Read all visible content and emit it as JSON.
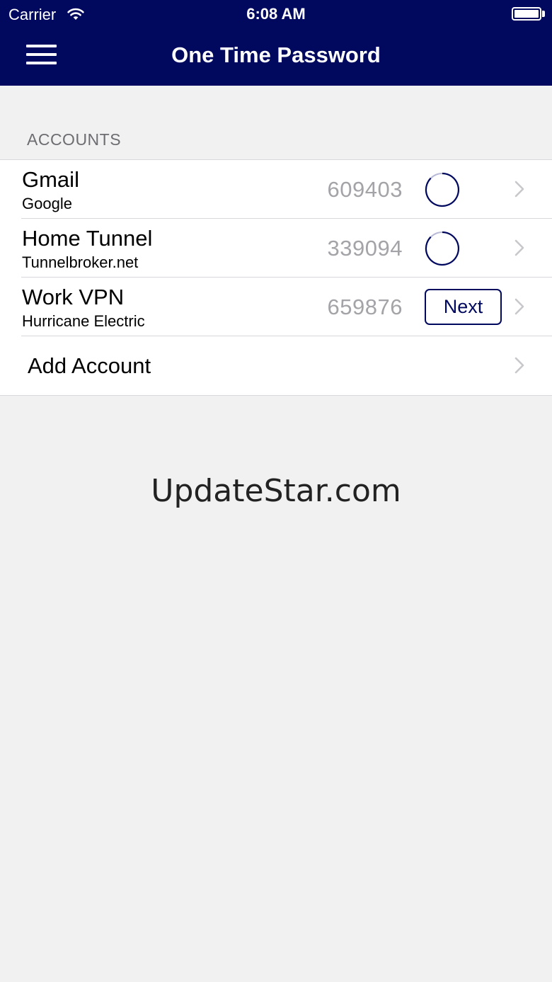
{
  "status_bar": {
    "carrier": "Carrier",
    "time": "6:08 AM",
    "wifi_icon": "wifi-icon",
    "battery_icon": "battery-icon"
  },
  "nav": {
    "title": "One Time Password",
    "menu_icon": "hamburger-menu-icon",
    "color": "#01095e"
  },
  "accounts": {
    "section_header": "ACCOUNTS",
    "items": [
      {
        "name": "Gmail",
        "issuer": "Google",
        "code": "609403",
        "action": "timer"
      },
      {
        "name": "Home Tunnel",
        "issuer": "Tunnelbroker.net",
        "code": "339094",
        "action": "timer"
      },
      {
        "name": "Work VPN",
        "issuer": "Hurricane Electric",
        "code": "659876",
        "action": "next",
        "next_label": "Next"
      }
    ],
    "add_label": "Add Account"
  },
  "watermark": "UpdateStar.com",
  "colors": {
    "accent": "#01095e",
    "background": "#f1f1f1",
    "code_text": "#a4a4a8",
    "section_text": "#6d6d72"
  }
}
